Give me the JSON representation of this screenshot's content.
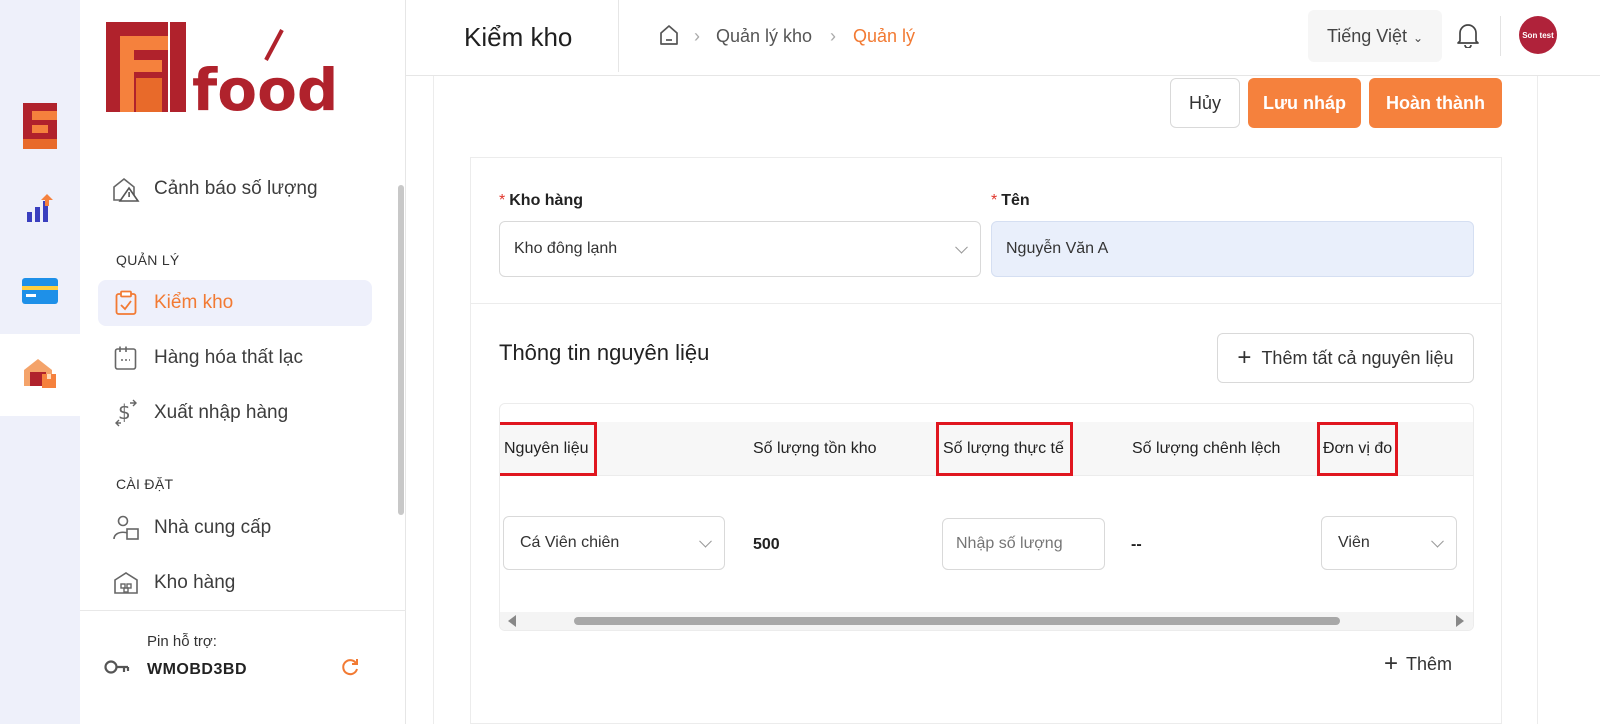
{
  "rail": {
    "icons": [
      "brand-f-icon",
      "analytics-chart-icon",
      "card-icon",
      "warehouse-box-icon"
    ]
  },
  "sidebar": {
    "logo_text": "food",
    "items_top": [
      {
        "label": "Cảnh báo số lượng",
        "icon": "warehouse-warning-icon"
      }
    ],
    "section_manage": "QUẢN LÝ",
    "items_manage": [
      {
        "label": "Kiểm kho",
        "icon": "clipboard-check-icon",
        "active": true
      },
      {
        "label": "Hàng hóa thất lạc",
        "icon": "lost-goods-icon"
      },
      {
        "label": "Xuất nhập hàng",
        "icon": "dollar-transfer-icon"
      }
    ],
    "section_settings": "CÀI ĐẶT",
    "items_settings": [
      {
        "label": "Nhà cung cấp",
        "icon": "supplier-icon"
      },
      {
        "label": "Kho hàng",
        "icon": "warehouse-icon"
      }
    ],
    "support": {
      "label": "Pin hỗ trợ:",
      "pin": "WMOBD3BD"
    }
  },
  "header": {
    "title": "Kiểm kho",
    "breadcrumb": [
      "Quản lý kho",
      "Quản lý"
    ],
    "language": "Tiếng Việt",
    "avatar_text": "Son test"
  },
  "actions": {
    "cancel": "Hủy",
    "save_draft": "Lưu nháp",
    "complete": "Hoàn thành"
  },
  "form": {
    "warehouse_label": "Kho hàng",
    "warehouse_value": "Kho đông lạnh",
    "name_label": "Tên",
    "name_value": "Nguyễn Văn A",
    "required_mark": "*"
  },
  "ingredients": {
    "title": "Thông tin nguyên liệu",
    "add_all": "Thêm tất cả nguyên liệu",
    "columns": [
      "Nguyên liệu",
      "Số lượng tồn kho",
      "Số lượng thực tế",
      "Số lượng chênh lệch",
      "Đơn vị đo"
    ],
    "rows": [
      {
        "ingredient": "Cá Viên chiên",
        "stock": "500",
        "actual_placeholder": "Nhập số lượng",
        "difference": "--",
        "unit": "Viên"
      }
    ],
    "add_row": "Thêm"
  },
  "colors": {
    "accent": "#f5813d",
    "highlight_box": "#e0161f",
    "active_bg": "#eef0fb"
  }
}
